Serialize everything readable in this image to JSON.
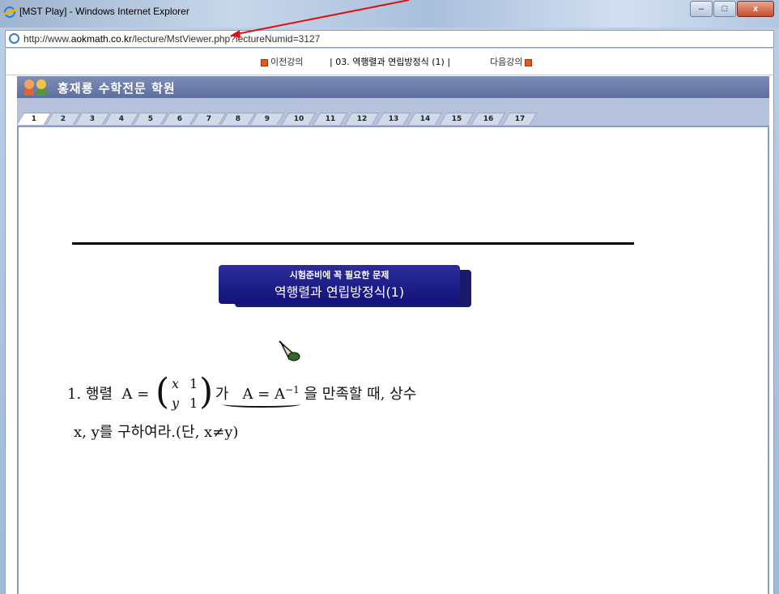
{
  "window": {
    "title": "[MST Play] - Windows Internet Explorer",
    "buttons": {
      "minimize": "–",
      "maximize": "□",
      "close": "x"
    }
  },
  "address": {
    "url_prefix": "http://www.",
    "url_domain": "aokmath.co.kr",
    "url_path": "/lecture/MstViewer.php?lectureNumid=3127"
  },
  "lecture_nav": {
    "prev": "이전강의",
    "title": "|  03. 역행렬과 연립방정식 (1)  |",
    "next": "다음강의"
  },
  "header": {
    "academy": "홍재룡 수학전문 학원"
  },
  "tabs": [
    "1",
    "2",
    "3",
    "4",
    "5",
    "6",
    "7",
    "8",
    "9",
    "10",
    "11",
    "12",
    "13",
    "14",
    "15",
    "16",
    "17"
  ],
  "active_tab": "1",
  "banner": {
    "subtitle": "시험준비에 꼭 필요한 문제",
    "title": "역행렬과 연립방정식(1)"
  },
  "problem": {
    "number": "1.",
    "word_matrix": "행렬",
    "lhs": "A =",
    "m11": "x",
    "m12": "1",
    "m21": "y",
    "m22": "1",
    "ga": "가",
    "condition": "A = A",
    "sup": "−1",
    "rest": "을 만족할 때, 상수",
    "line2": "x, y를 구하여라.(단, x≠y)"
  },
  "colors": {
    "accent": "#13137a",
    "header": "#5d6f9e"
  }
}
